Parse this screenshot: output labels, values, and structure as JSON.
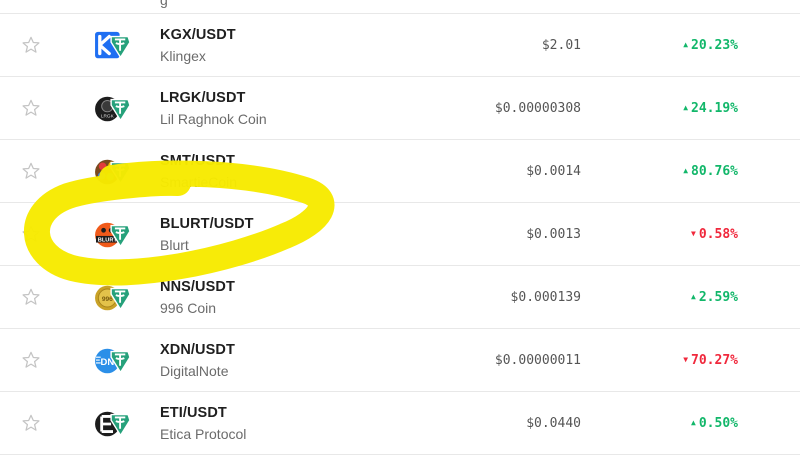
{
  "top_row": {
    "name_fragment": "g"
  },
  "rows": [
    {
      "pair": "KGX/USDT",
      "name": "Klingex",
      "price": "$2.01",
      "change": "20.23%",
      "direction": "up",
      "icon": "klingex-logo-icon"
    },
    {
      "pair": "LRGK/USDT",
      "name": "Lil Raghnok Coin",
      "price": "$0.00000308",
      "change": "24.19%",
      "direction": "up",
      "icon": "lrgk-logo-icon"
    },
    {
      "pair": "SMT/USDT",
      "name": "SmartieCoin",
      "price": "$0.0014",
      "change": "80.76%",
      "direction": "up",
      "icon": "smartiecoin-logo-icon"
    },
    {
      "pair": "BLURT/USDT",
      "name": "Blurt",
      "price": "$0.0013",
      "change": "0.58%",
      "direction": "down",
      "icon": "blurt-logo-icon"
    },
    {
      "pair": "NNS/USDT",
      "name": "996 Coin",
      "price": "$0.000139",
      "change": "2.59%",
      "direction": "up",
      "icon": "996coin-logo-icon"
    },
    {
      "pair": "XDN/USDT",
      "name": "DigitalNote",
      "price": "$0.00000011",
      "change": "70.27%",
      "direction": "down",
      "icon": "digitalnote-logo-icon"
    },
    {
      "pair": "ETI/USDT",
      "name": "Etica Protocol",
      "price": "$0.0440",
      "change": "0.50%",
      "direction": "up",
      "icon": "etica-logo-icon"
    }
  ],
  "colors": {
    "up": "#12b76a",
    "down": "#f0283c",
    "highlight": "#f7ea00",
    "tether": "#26a17b"
  }
}
